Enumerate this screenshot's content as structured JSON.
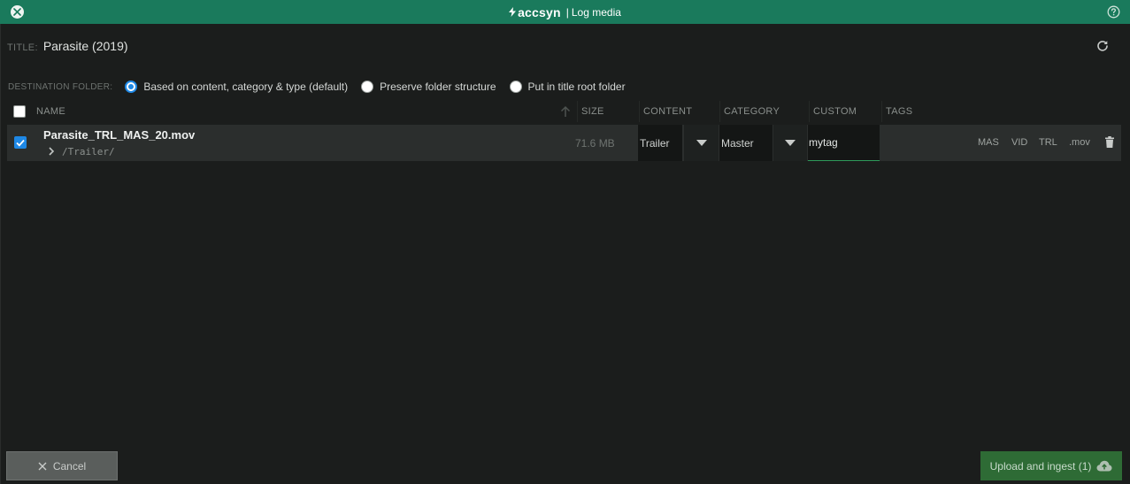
{
  "header": {
    "brand": "accsyn",
    "separator": "|",
    "title": "Log media"
  },
  "title_section": {
    "label": "TITLE:",
    "value": "Parasite (2019)"
  },
  "destination": {
    "label": "DESTINATION FOLDER:",
    "options": [
      {
        "label": "Based on content, category & type (default)",
        "selected": true
      },
      {
        "label": "Preserve folder structure",
        "selected": false
      },
      {
        "label": "Put in title root folder",
        "selected": false
      }
    ]
  },
  "table": {
    "columns": [
      "NAME",
      "SIZE",
      "CONTENT",
      "CATEGORY",
      "CUSTOM",
      "TAGS"
    ],
    "sort_column": "NAME",
    "rows": [
      {
        "checked": true,
        "name": "Parasite_TRL_MAS_20.mov",
        "path": "/Trailer/",
        "size": "71.6 MB",
        "content": "Trailer",
        "category": "Master",
        "custom": "mytag",
        "tags": [
          "MAS",
          "VID",
          "TRL",
          ".mov"
        ]
      }
    ]
  },
  "footer": {
    "cancel_label": "Cancel",
    "upload_label": "Upload and ingest (1)"
  },
  "colors": {
    "header_bg": "#1a7a5c",
    "accent_blue": "#1e88e5",
    "upload_bg": "#2e6b35",
    "input_underline": "#2e9a5a"
  }
}
